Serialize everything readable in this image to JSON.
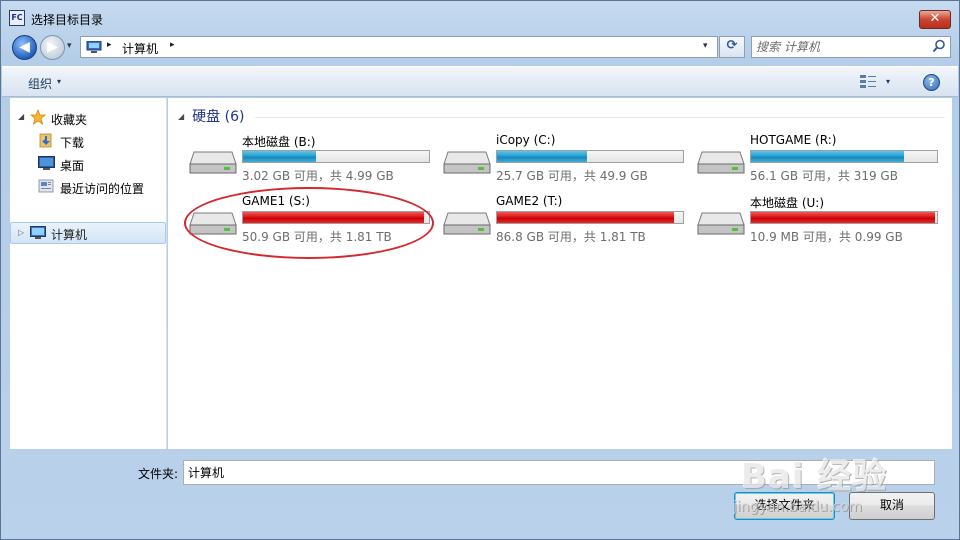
{
  "window": {
    "title": "选择目标目录",
    "app_icon_text": "FC",
    "close_label": "✕"
  },
  "nav": {
    "back_glyph": "◀",
    "forward_glyph": "▶",
    "history_caret": "▾"
  },
  "address": {
    "path": "计算机",
    "sep": "▸",
    "dropdown": "▾",
    "refresh_glyph": "⟳"
  },
  "search": {
    "placeholder": "搜索 计算机"
  },
  "toolbar": {
    "organize_label": "组织",
    "caret": "▾",
    "help_label": "?"
  },
  "sidebar": {
    "favorites_label": "收藏夹",
    "items": [
      {
        "label": "下载"
      },
      {
        "label": "桌面"
      },
      {
        "label": "最近访问的位置"
      }
    ],
    "computer_label": "计算机"
  },
  "content": {
    "group_label": "硬盘 (6)",
    "drives": [
      {
        "name": "本地磁盘 (B:)",
        "info": "3.02 GB 可用，共 4.99 GB",
        "used_fraction": 0.395,
        "status_color": "#26a0d2"
      },
      {
        "name": "iCopy (C:)",
        "info": "25.7 GB 可用，共 49.9 GB",
        "used_fraction": 0.485,
        "status_color": "#26a0d2"
      },
      {
        "name": "HOTGAME (R:)",
        "info": "56.1 GB 可用，共 319 GB",
        "used_fraction": 0.824,
        "status_color": "#26a0d2"
      },
      {
        "name": "GAME1 (S:)",
        "info": "50.9 GB 可用，共 1.81 TB",
        "used_fraction": 0.973,
        "status_color": "#d81818"
      },
      {
        "name": "GAME2 (T:)",
        "info": "86.8 GB 可用，共 1.81 TB",
        "used_fraction": 0.953,
        "status_color": "#d81818"
      },
      {
        "name": "本地磁盘 (U:)",
        "info": "10.9 MB 可用，共 0.99 GB",
        "used_fraction": 0.989,
        "status_color": "#d81818"
      }
    ]
  },
  "footer": {
    "folder_label": "文件夹:",
    "folder_value": "计算机",
    "select_button": "选择文件夹",
    "cancel_button": "取消"
  },
  "watermark": {
    "brand": "Bai 经验",
    "sub": "jingyan.baidu.com"
  }
}
